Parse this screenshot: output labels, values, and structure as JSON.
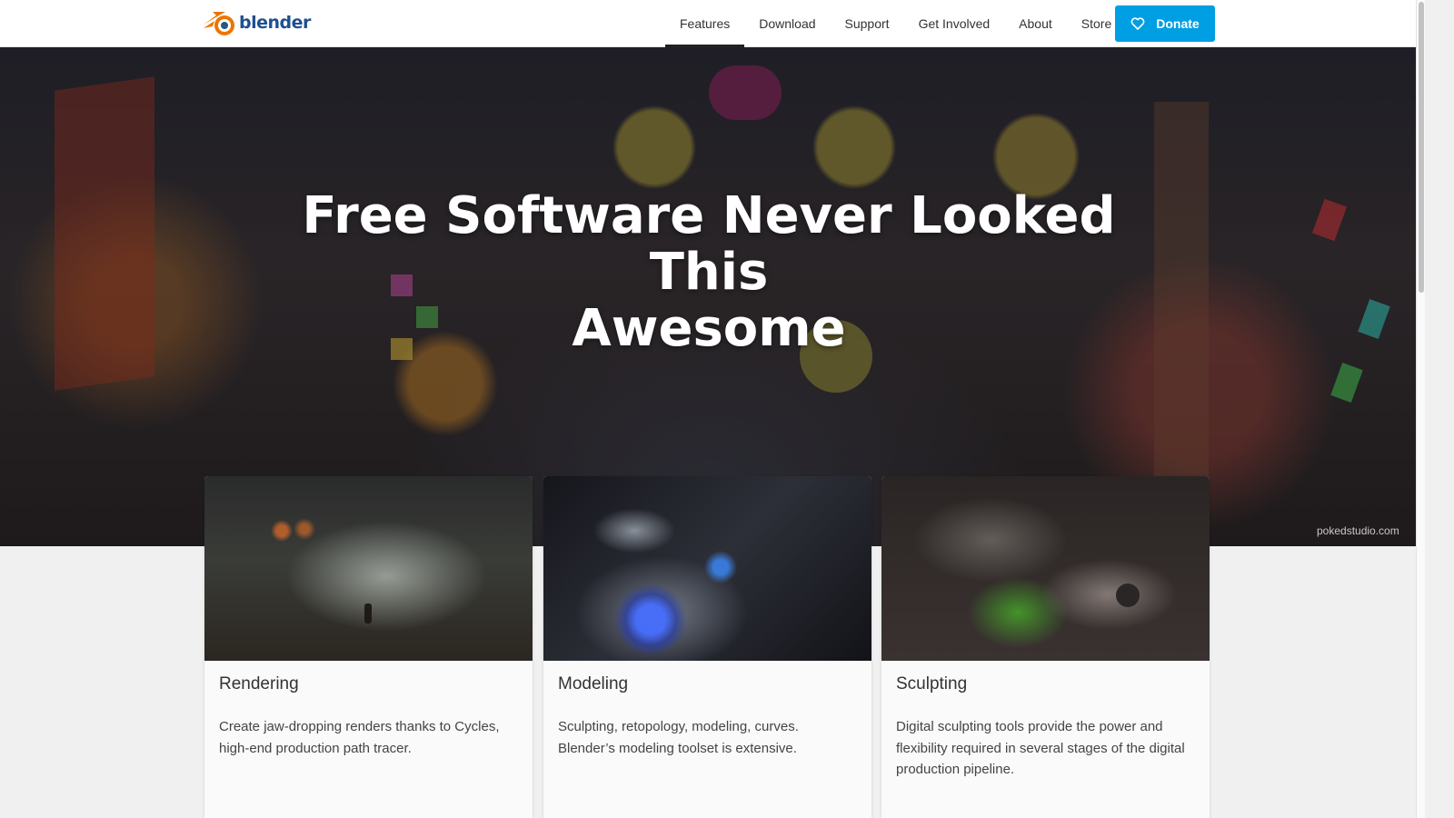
{
  "brand": {
    "logo_text": "blender",
    "logo_color": "#ea7600",
    "text_color": "#1f4f8f"
  },
  "nav": {
    "items": [
      {
        "label": "Features",
        "active": true
      },
      {
        "label": "Download",
        "active": false
      },
      {
        "label": "Support",
        "active": false
      },
      {
        "label": "Get Involved",
        "active": false
      },
      {
        "label": "About",
        "active": false
      },
      {
        "label": "Store",
        "active": false
      }
    ],
    "donate_label": "Donate",
    "donate_icon": "heart-icon",
    "donate_color": "#009fe3"
  },
  "hero": {
    "title_line1": "Free Software Never Looked This",
    "title_line2": "Awesome",
    "credit": "pokedstudio.com"
  },
  "cards": [
    {
      "title": "Rendering",
      "text": "Create jaw-dropping renders thanks to Cycles, high-end production path tracer."
    },
    {
      "title": "Modeling",
      "text": "Sculpting, retopology, modeling, curves. Blender’s modeling toolset is extensive."
    },
    {
      "title": "Sculpting",
      "text": "Digital sculpting tools provide the power and flexibility required in several stages of the digital production pipeline."
    }
  ]
}
